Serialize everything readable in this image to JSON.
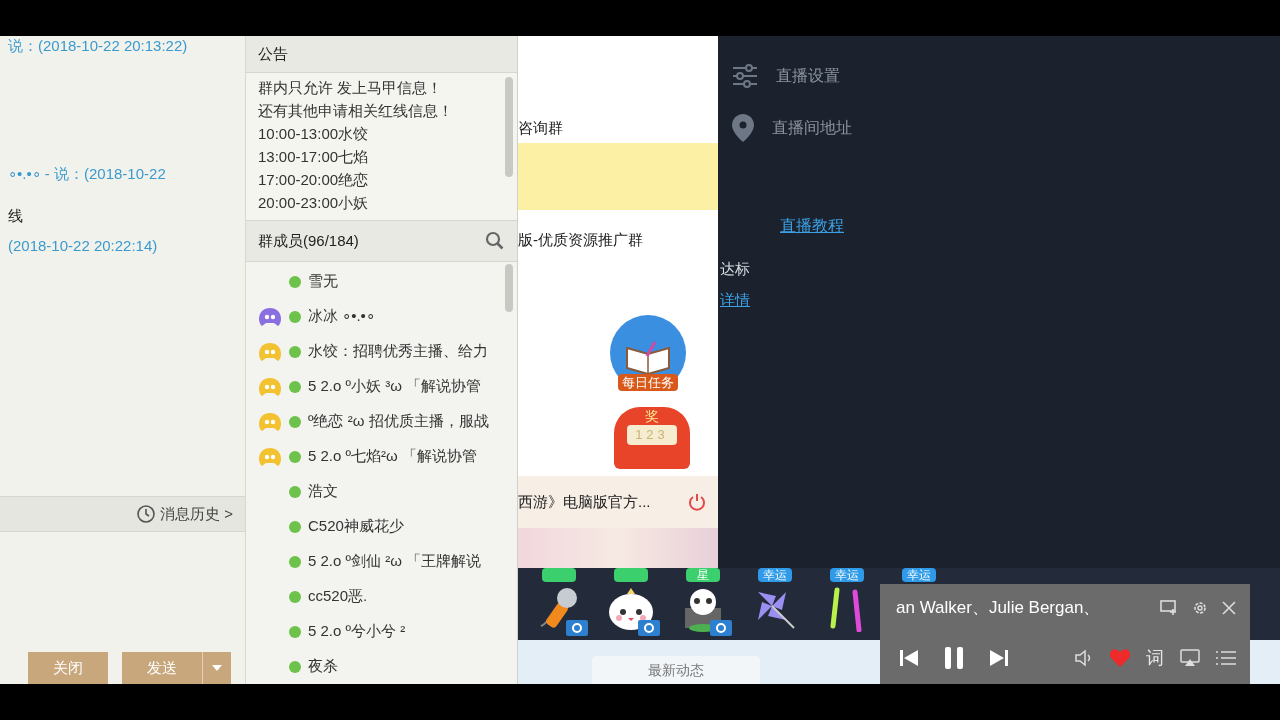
{
  "chat": {
    "messages": [
      {
        "kind": "meta",
        "text": "说：(2018-10-22 20:13:22)"
      },
      {
        "kind": "meta",
        "text": "∘•.•∘ - 说：(2018-10-22"
      },
      {
        "kind": "body",
        "text": "线"
      },
      {
        "kind": "meta",
        "text": "(2018-10-22 20:22:14)"
      }
    ],
    "history_link": "消息历史 >",
    "buttons": [
      {
        "label": "关闭",
        "dropdown": false
      },
      {
        "label": "发送",
        "dropdown": true
      }
    ]
  },
  "notice": {
    "title": "公告",
    "lines": [
      "群内只允许 发上马甲信息！",
      "还有其他申请相关红线信息！",
      "10:00-13:00水饺",
      "13:00-17:00七焰",
      "17:00-20:00绝恋",
      "20:00-23:00小妖"
    ]
  },
  "members": {
    "title": "群成员(96/184)",
    "items": [
      {
        "name": "雪无"
      },
      {
        "name": "冰冰 ∘•.•∘",
        "color": "#8a6fe0"
      },
      {
        "name": "水饺：招聘优秀主播、给力",
        "color": "#f2c230"
      },
      {
        "name": "5 2.o º小妖 ³ω 「解说协管",
        "color": "#f2c230"
      },
      {
        "name": "º绝恋 ²ω 招优质主播，服战",
        "color": "#f2c230"
      },
      {
        "name": "5 2.o º七焰²ω 「解说协管",
        "color": "#f2c230"
      },
      {
        "name": "浩文"
      },
      {
        "name": "C520神威花少"
      },
      {
        "name": "5 2.o º剑仙 ²ω 「王牌解说"
      },
      {
        "name": "cc520恶."
      },
      {
        "name": "5 2.o º兮小兮 ²"
      },
      {
        "name": "夜杀"
      }
    ]
  },
  "groups": {
    "items": [
      {
        "name": "咨询群",
        "selected": false
      },
      {
        "selected": true
      },
      {
        "name": "版-优质资源推广群",
        "selected": false
      }
    ],
    "daily_task": "每日任务",
    "lottery": {
      "sign": "奖",
      "digits": "123"
    },
    "game": "西游》电脑版官方..."
  },
  "live_menu": {
    "items": [
      {
        "kind": "settings",
        "label": "直播设置"
      },
      {
        "kind": "pin",
        "label": "直播间地址"
      }
    ],
    "tutorial_link": "直播教程",
    "status": "达标",
    "details_link": "详情"
  },
  "gifts": [
    {
      "kind": "mic",
      "color": "#3ccf6e",
      "camera": true
    },
    {
      "kind": "bun",
      "color": "#3ccf6e",
      "camera": true
    },
    {
      "kind": "panda",
      "tag": "星",
      "color": "#3ccf6e",
      "camera": true
    },
    {
      "kind": "pinwheel",
      "tag": "幸运",
      "color": "#2f9be8",
      "camera": false
    },
    {
      "kind": "sticks",
      "tag": "幸运",
      "color": "#2f9be8",
      "camera": false
    },
    {
      "kind": "none",
      "tag": "幸运",
      "color": "#2f9be8",
      "camera": false
    }
  ],
  "feed_tab": "最新动态",
  "player": {
    "title": "an Walker、Julie Bergan、",
    "playing": true,
    "liked": true,
    "lyrics": "词"
  }
}
